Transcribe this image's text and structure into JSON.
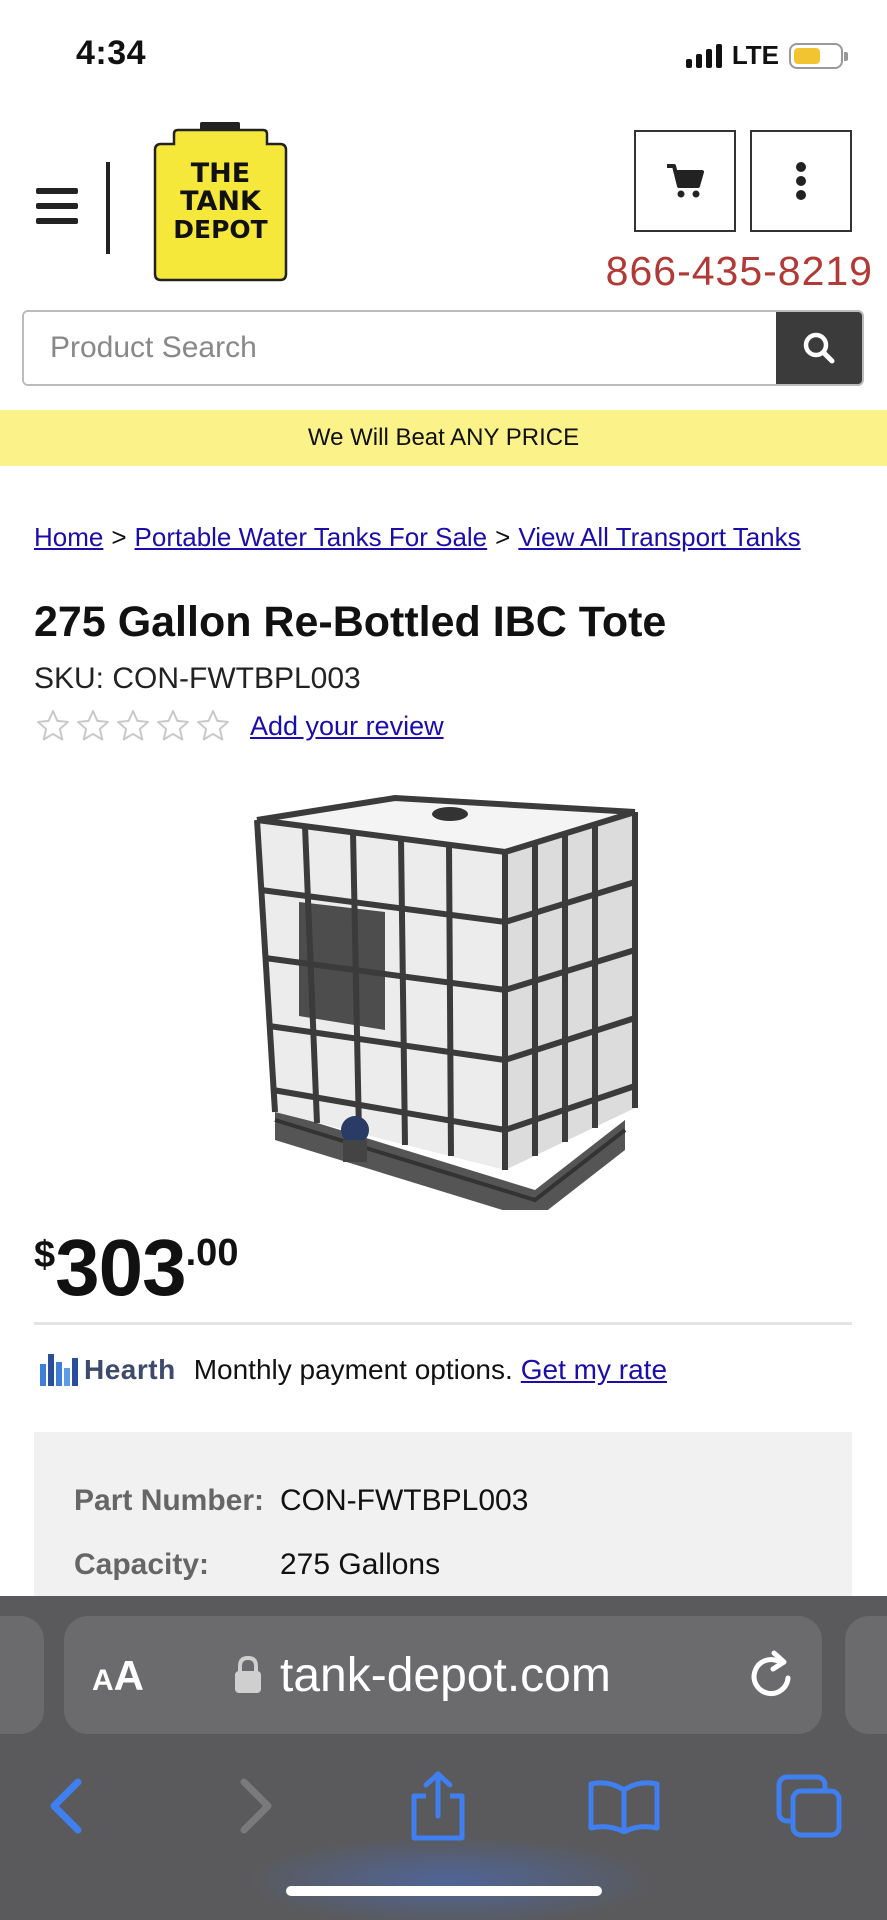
{
  "status_bar": {
    "time": "4:34",
    "network": "LTE",
    "battery_level": 0.6,
    "battery_color": "#f3c431"
  },
  "header": {
    "menu_icon": "hamburger-menu-icon",
    "logo": {
      "line1": "THE",
      "line2": "TANK",
      "line3": "DEPOT",
      "color": "#f5e83a"
    },
    "cart_icon": "cart-icon",
    "more_icon": "more-vertical-icon",
    "phone": "866-435-8219",
    "phone_color": "#b13a37"
  },
  "search": {
    "placeholder": "Product Search",
    "button_icon": "search-icon"
  },
  "promo": {
    "text": "We Will Beat ANY PRICE",
    "background": "#fbf38a"
  },
  "breadcrumb": {
    "items": [
      {
        "label": "Home"
      },
      {
        "label": "Portable Water Tanks For Sale"
      },
      {
        "label": "View All Transport Tanks"
      }
    ],
    "separator": ">"
  },
  "product": {
    "title": "275 Gallon Re-Bottled IBC Tote",
    "sku": "SKU: CON-FWTBPL003",
    "rating": 0,
    "rating_max": 5,
    "review_link": "Add your review",
    "price": {
      "currency": "$",
      "dollars": "303",
      "cents": ".00"
    },
    "financing": {
      "brand": "Hearth",
      "text": "Monthly payment options.",
      "link": "Get my rate"
    },
    "specs": [
      {
        "label": "Part Number:",
        "value": "CON-FWTBPL003"
      },
      {
        "label": "Capacity:",
        "value": "275 Gallons"
      }
    ]
  },
  "browser": {
    "text_size_small": "A",
    "text_size_big": "A",
    "url": "tank-depot.com",
    "icons": [
      "back-icon",
      "forward-icon",
      "share-icon",
      "bookmarks-icon",
      "tabs-icon"
    ]
  }
}
